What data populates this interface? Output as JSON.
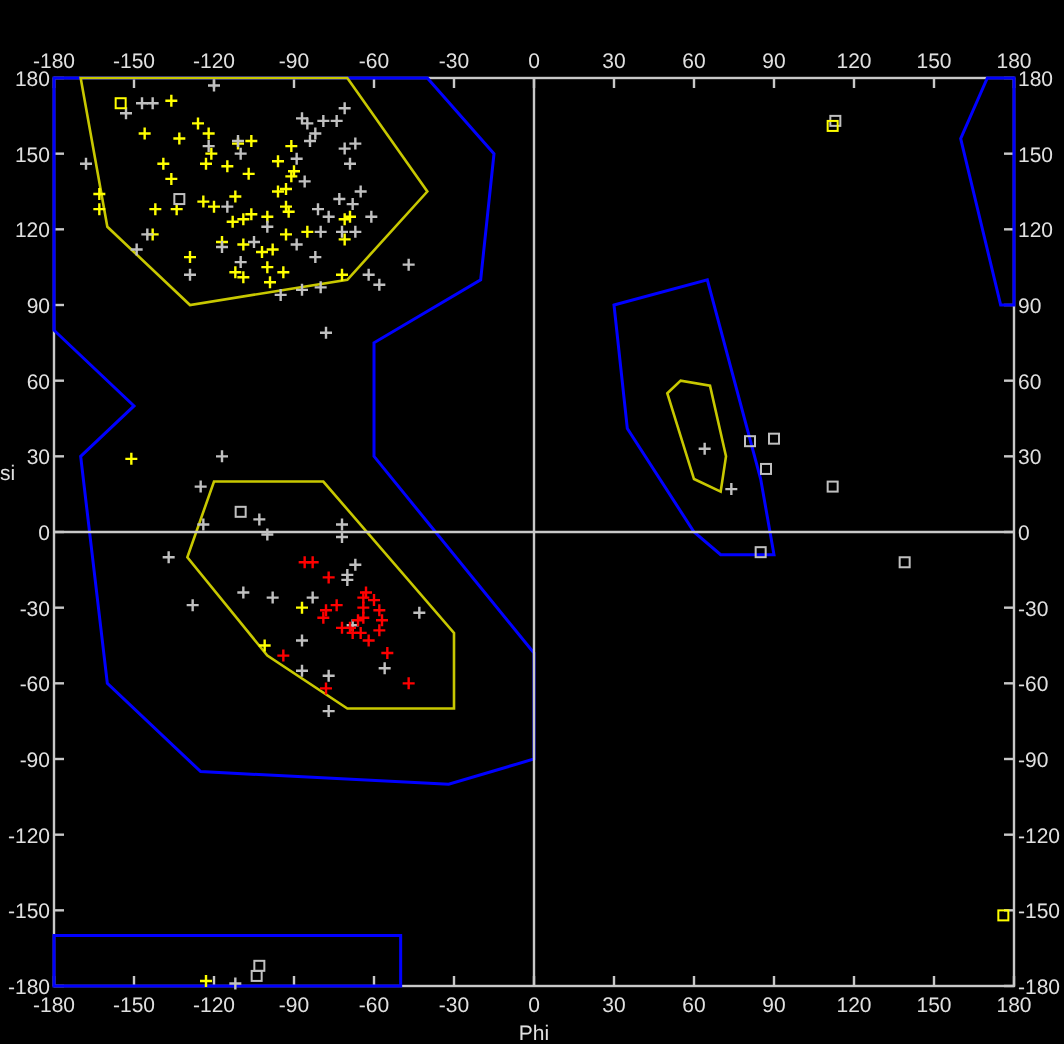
{
  "top_axis": {
    "labels": [
      "-180",
      "-150",
      "-120",
      "-90",
      "-60",
      "-30",
      "0",
      "30",
      "60",
      "90",
      "120",
      "150",
      "180"
    ]
  },
  "right_axis": {
    "labels": [
      "180",
      "150",
      "120",
      "90",
      "60",
      "30",
      "0",
      "-30",
      "-60",
      "-90",
      "-120",
      "-150",
      "-180"
    ]
  },
  "bottom_axis": {
    "labels": [
      "-180",
      "-150",
      "-120",
      "-90",
      "-60",
      "-30",
      "0",
      "30",
      "60",
      "90",
      "120",
      "150",
      "180"
    ]
  },
  "chart_data": {
    "type": "scatter",
    "xlabel": "Phi",
    "ylabel": "si",
    "xlim": [
      -180,
      180
    ],
    "ylim": [
      -180,
      180
    ],
    "xticks": [
      -180,
      -150,
      -120,
      -90,
      -60,
      -30,
      0,
      30,
      60,
      90,
      120,
      150,
      180
    ],
    "yticks": [
      -180,
      -150,
      -120,
      -90,
      -60,
      -30,
      0,
      30,
      60,
      90,
      120,
      150,
      180
    ],
    "series": [
      {
        "color": "#ffff00",
        "marker": "cross",
        "x": [
          -136,
          -146,
          -133,
          -126,
          -122,
          -139,
          -136,
          -123,
          -121,
          -115,
          -111,
          -106,
          -107,
          -112,
          -142,
          -143,
          -134,
          -124,
          -120,
          -117,
          -113,
          -109,
          -106,
          -100,
          -109,
          -102,
          -98,
          -93,
          -96,
          -93,
          -91,
          -90,
          -91,
          -96,
          -93,
          -92,
          -85,
          -100,
          -94,
          -99,
          -112,
          -109,
          -129,
          -72,
          -71,
          -69,
          -71,
          -163,
          -163,
          -151,
          -87,
          -101,
          -123
        ],
        "values": [
          171,
          158,
          156,
          162,
          158,
          146,
          140,
          146,
          150,
          145,
          154,
          155,
          142,
          133,
          128,
          118,
          128,
          131,
          129,
          115,
          123,
          124,
          126,
          125,
          114,
          111,
          112,
          118,
          135,
          136,
          141,
          143,
          153,
          147,
          129,
          127,
          119,
          105,
          103,
          99,
          103,
          101,
          109,
          102,
          116,
          125,
          124,
          134,
          128,
          29,
          -30,
          -45,
          -178
        ]
      },
      {
        "color": "#c0c0c0",
        "marker": "cross",
        "x": [
          -153,
          -147,
          -143,
          -168,
          -149,
          -145,
          -129,
          -120,
          -122,
          -111,
          -110,
          -115,
          -117,
          -110,
          -105,
          -95,
          -87,
          -80,
          -78,
          -87,
          -85,
          -84,
          -82,
          -79,
          -74,
          -71,
          -71,
          -67,
          -69,
          -89,
          -86,
          -81,
          -77,
          -80,
          -73,
          -65,
          -68,
          -61,
          -72,
          -67,
          -82,
          -62,
          -58,
          -47,
          -89,
          -100,
          -117,
          -125,
          -124,
          -103,
          -100,
          -137,
          -128,
          -109,
          -98,
          -83,
          -87,
          -87,
          -77,
          -77,
          -72,
          -72,
          -70,
          -70,
          -67,
          -68,
          -56,
          -43,
          64,
          74,
          -112
        ],
        "values": [
          166,
          170,
          170,
          146,
          112,
          118,
          102,
          177,
          153,
          155,
          150,
          129,
          113,
          107,
          115,
          94,
          96,
          97,
          79,
          164,
          162,
          155,
          158,
          163,
          163,
          168,
          152,
          154,
          146,
          148,
          139,
          128,
          125,
          119,
          132,
          135,
          130,
          125,
          119,
          119,
          109,
          102,
          98,
          106,
          114,
          121,
          30,
          18,
          3,
          5,
          -1,
          -10,
          -29,
          -24,
          -26,
          -26,
          -43,
          -55,
          -57,
          -71,
          3,
          -2,
          -17,
          -19,
          -13,
          -37,
          -54,
          -32,
          33,
          17,
          -179
        ]
      },
      {
        "color": "#ff0000",
        "marker": "cross",
        "x": [
          -86,
          -83,
          -77,
          -74,
          -78,
          -79,
          -72,
          -68,
          -65,
          -64,
          -64,
          -63,
          -64,
          -60,
          -58,
          -57,
          -58,
          -62,
          -66,
          -69,
          -55,
          -47,
          -78,
          -94
        ],
        "values": [
          -12,
          -12,
          -18,
          -29,
          -31,
          -34,
          -38,
          -40,
          -40,
          -34,
          -30,
          -24,
          -26,
          -27,
          -31,
          -35,
          -39,
          -43,
          -35,
          -38,
          -48,
          -60,
          -62,
          -49
        ]
      },
      {
        "color": "#c0c0c0",
        "marker": "square",
        "x": [
          -133,
          -110,
          81,
          90,
          87,
          112,
          85,
          139,
          113,
          -103,
          -104
        ],
        "values": [
          132,
          8,
          36,
          37,
          25,
          18,
          -8,
          -12,
          163,
          -172,
          -176
        ]
      },
      {
        "color": "#ffff00",
        "marker": "square",
        "x": [
          -155,
          112,
          176
        ],
        "values": [
          170,
          161,
          -152
        ]
      }
    ]
  }
}
